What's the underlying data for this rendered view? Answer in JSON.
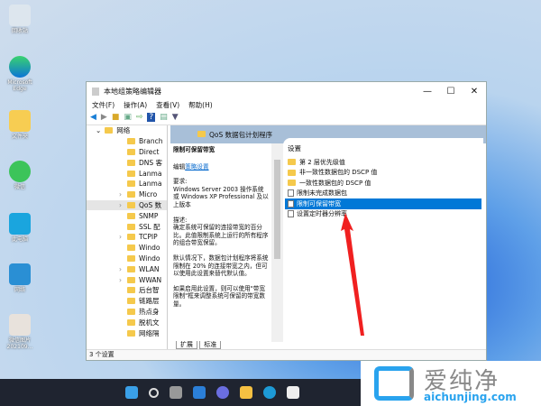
{
  "desktop": [
    "回收站",
    "Microsoft Edge",
    "文件夹",
    "微信",
    "此电脑",
    "网络",
    "微信图片 202109..."
  ],
  "window": {
    "title": "本地组策略编辑器",
    "controls": [
      "—",
      "☐",
      "✕"
    ],
    "menu": [
      "文件(F)",
      "操作(A)",
      "查看(V)",
      "帮助(H)"
    ],
    "tree": [
      {
        "label": "网络",
        "expanded": true
      },
      {
        "label": "Branch"
      },
      {
        "label": "Direct"
      },
      {
        "label": "DNS 客"
      },
      {
        "label": "Lanma"
      },
      {
        "label": "Lanma"
      },
      {
        "label": "Micro"
      },
      {
        "label": "QoS 数"
      },
      {
        "label": "SNMP"
      },
      {
        "label": "SSL 配"
      },
      {
        "label": "TCPIP"
      },
      {
        "label": "Windo"
      },
      {
        "label": "Windo"
      },
      {
        "label": "WLAN"
      },
      {
        "label": "WWAN"
      },
      {
        "label": "后台智"
      },
      {
        "label": "链路层"
      },
      {
        "label": "热点身"
      },
      {
        "label": "脱机文"
      },
      {
        "label": "网络隔"
      }
    ],
    "header": "QoS 数据包计划程序",
    "desc": {
      "title": "限制可保留带宽",
      "edit_prefix": "编辑",
      "edit_link": "策略设置",
      "req_label": "要求:",
      "req": "Windows Server 2003 操作系统或 Windows XP Professional 及以上版本",
      "desc_label": "描述:",
      "p1": "确定系统可保留的连接带宽的百分比。此值限制系统上运行的所有程序的组合带宽保留。",
      "p2": "默认情况下，数据包计划程序将系统限制在 20% 的连接带宽之内，但可以使用此设置来替代默认值。",
      "p3": "如果启用此设置，则可以使用\"带宽限制\"框来调整系统可保留的带宽数量。"
    },
    "list": {
      "column": "设置",
      "items": [
        {
          "label": "第 2 层优先级值",
          "type": "folder"
        },
        {
          "label": "非一致性数据包的 DSCP 值",
          "type": "folder"
        },
        {
          "label": "一致性数据包的 DSCP 值",
          "type": "folder"
        },
        {
          "label": "限制未完成数据包",
          "type": "setting"
        },
        {
          "label": "限制可保留带宽",
          "type": "setting",
          "selected": true
        },
        {
          "label": "设置定时器分辨率",
          "type": "setting"
        }
      ]
    },
    "tabs": [
      "扩展",
      "标准"
    ],
    "status": "3 个设置"
  },
  "watermark": {
    "text": "爱纯净",
    "url": "aichunjing.com"
  }
}
